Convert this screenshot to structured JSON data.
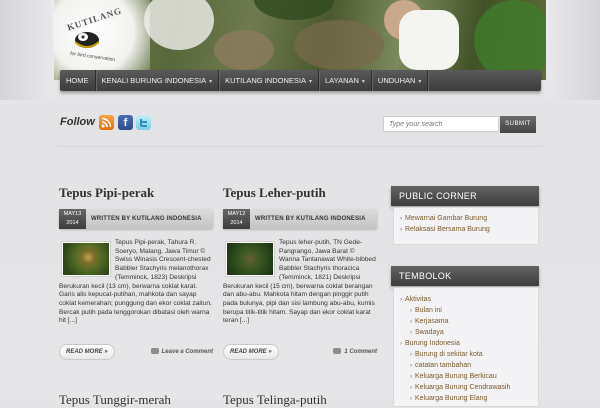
{
  "header": {
    "logo_text": "KUTILANG",
    "logo_tagline": "for bird conservation"
  },
  "nav": [
    {
      "label": "HOME",
      "has_dropdown": false
    },
    {
      "label": "KENALI BURUNG INDONESIA",
      "has_dropdown": true
    },
    {
      "label": "KUTILANG INDONESIA",
      "has_dropdown": true
    },
    {
      "label": "LAYANAN",
      "has_dropdown": true
    },
    {
      "label": "UNDUHAN",
      "has_dropdown": true
    }
  ],
  "follow": {
    "label": "Follow",
    "icons": [
      "rss-icon",
      "facebook-icon",
      "twitter-icon"
    ],
    "facebook_glyph": "f"
  },
  "search": {
    "placeholder": "Type your search",
    "button_label": "SUBMIT"
  },
  "posts": [
    {
      "title": "Tepus Pipi-perak",
      "date_month_day": "MAY13",
      "date_year": "2014",
      "byline": "WRITTEN BY KUTILANG INDONESIA",
      "excerpt": "Tepus Pipi-perak, Tahura R. Soeryo, Malang, Jawa Timur © Swiss Winasis Crescent-chested Babbler Stachyris melanothorax (Temminck, 1823) Deskripsi Berukuran kecil (13 cm), berwarna coklat karat. Garis alis kepucat-putihan, mahkota dan sayap coklat kemerahan; punggung dan ekor coklat zaitun. Bercak putih pada tenggorokan dibatasi oleh warna hit [...]",
      "read_more": "READ MORE »",
      "comments": "Leave a Comment"
    },
    {
      "title": "Tepus Leher-putih",
      "date_month_day": "MAY12",
      "date_year": "2014",
      "byline": "WRITTEN BY KUTILANG INDONESIA",
      "excerpt": "Tepus leher-putih, TN Gede-Pangrango, Jawa Barat © Wanna Tantanawat White-bibbed Babbler Stachyris thoracica (Temminck, 1821) Deskripsi Berukuran kecil (15 cm), berwarna coklat berangan dan abu-abu. Mahkota hitam dengan pinggir putih pada bulunya, pipi dan sisi lambung abu-abu, kumis berupa titik-titik hitam. Sayap dan ekor coklat karat teran [...]",
      "read_more": "READ MORE »",
      "comments": "1 Comment"
    }
  ],
  "next_posts": [
    "Tepus Tunggir-merah",
    "Tepus Telinga-putih"
  ],
  "sidebar": {
    "public_corner": {
      "title": "PUBLIC CORNER",
      "items": [
        "Mewarnai Gambar Burung",
        "Relaksasi Bersama Burung"
      ]
    },
    "tembolok": {
      "title": "TEMBOLOK",
      "items": [
        {
          "label": "Aktivitas",
          "level": 0
        },
        {
          "label": "Bulan ini",
          "level": 1
        },
        {
          "label": "Kerjasama",
          "level": 1
        },
        {
          "label": "Swadaya",
          "level": 1
        },
        {
          "label": "Burung Indonesia",
          "level": 0
        },
        {
          "label": "Burung di sekitar kota",
          "level": 1
        },
        {
          "label": "catatan tambahan",
          "level": 1
        },
        {
          "label": "Keluarga Burung Berkicau",
          "level": 1
        },
        {
          "label": "Keluarga Burung Cendrawasih",
          "level": 1
        },
        {
          "label": "Keluarga Burung Elang",
          "level": 1
        }
      ]
    }
  }
}
